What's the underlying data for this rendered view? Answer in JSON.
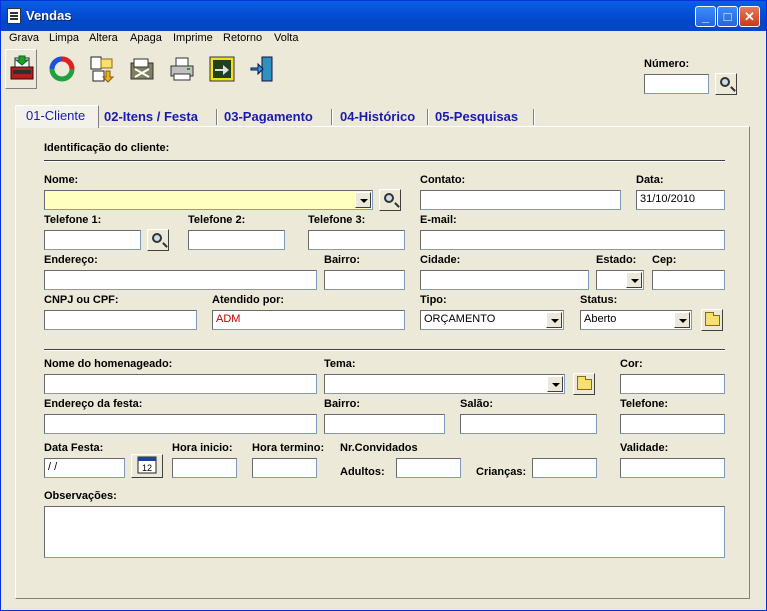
{
  "window": {
    "title": "Vendas",
    "min_label": "_",
    "max_label": "□",
    "close_label": "✕"
  },
  "menu": [
    "Grava",
    "Limpa",
    "Altera",
    "Apaga",
    "Imprime",
    "Retorno",
    "Volta"
  ],
  "toolbar": {
    "tools": [
      "save-tool",
      "refresh-tool",
      "edit-tool",
      "delete-tool",
      "print-tool",
      "return-tool",
      "exit-tool"
    ],
    "numero_label": "Número:",
    "numero_value": ""
  },
  "tabs": [
    "01-Cliente",
    "02-Itens / Festa",
    "03-Pagamento",
    "04-Histórico",
    "05-Pesquisas"
  ],
  "section": {
    "title": "Identificação do cliente:"
  },
  "labels": {
    "nome": "Nome:",
    "contato": "Contato:",
    "data": "Data:",
    "telefone1": "Telefone 1:",
    "telefone2": "Telefone 2:",
    "telefone3": "Telefone 3:",
    "email": "E-mail:",
    "endereco": "Endereço:",
    "bairro": "Bairro:",
    "cidade": "Cidade:",
    "estado": "Estado:",
    "cep": "Cep:",
    "cnpj": "CNPJ ou CPF:",
    "atendido": "Atendido por:",
    "tipo": "Tipo:",
    "status": "Status:",
    "homenageado": "Nome do homenageado:",
    "tema": "Tema:",
    "cor": "Cor:",
    "endereco_festa": "Endereço da festa:",
    "bairro_festa": "Bairro:",
    "salao": "Salão:",
    "telefone_festa": "Telefone:",
    "data_festa": "Data Festa:",
    "hora_inicio": "Hora inicio:",
    "hora_termino": "Hora termino:",
    "nr_convidados": "Nr.Convidados",
    "adultos": "Adultos:",
    "criancas": "Crianças:",
    "validade": "Validade:",
    "observacoes": "Observações:"
  },
  "values": {
    "data": "31/10/2010",
    "atendido": "ADM",
    "tipo": "ORÇAMENTO",
    "status": "Aberto",
    "data_festa": " / /",
    "calendar_icon_text": "12"
  }
}
